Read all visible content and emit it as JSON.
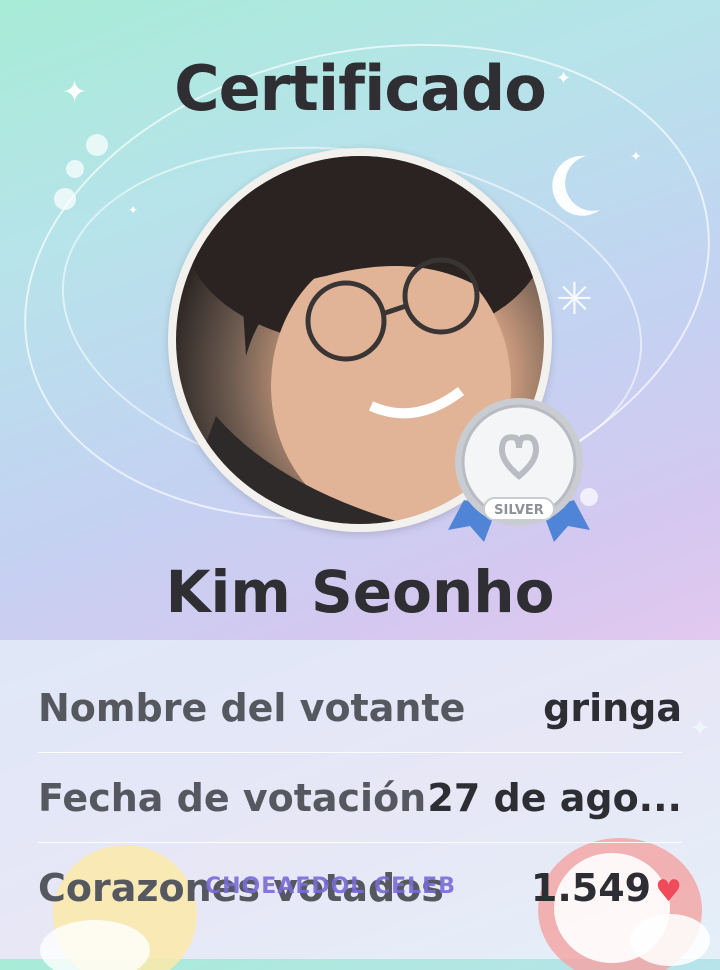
{
  "certificate": {
    "title": "Certificado",
    "artist_name": "Kim Seonho",
    "badge": {
      "label": "SILVER",
      "icon": "silver-medal-icon"
    }
  },
  "details": {
    "voter_label": "Nombre del votante",
    "voter_value": "gringa",
    "date_label": "Fecha de votación",
    "date_value": "27 de ago...",
    "hearts_label": "Corazones votados",
    "hearts_value": "1.549",
    "heart_icon": "heart-icon"
  },
  "watermark": "CHOEAEDOL CELEB",
  "colors": {
    "text_dark": "#2f2f33",
    "label_gray": "#55585e",
    "heart_red": "#ef4b5a",
    "badge_ribbon": "#4f84d6"
  }
}
